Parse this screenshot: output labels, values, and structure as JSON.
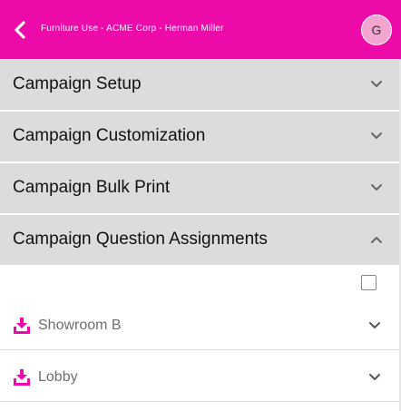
{
  "header": {
    "title": "Furniture Use - ACME Corp - Herman Miller",
    "avatar_initial": "G",
    "brand_color": "#ec0aa8",
    "back_icon": "chevron-left-icon"
  },
  "sections": [
    {
      "label": "Campaign Setup",
      "expanded": false
    },
    {
      "label": "Campaign Customization",
      "expanded": false
    },
    {
      "label": "Campaign Bulk Print",
      "expanded": false
    },
    {
      "label": "Campaign Question Assignments",
      "expanded": true
    }
  ],
  "assignments": {
    "select_all_checked": false,
    "items": [
      {
        "label": "Showroom B",
        "icon": "download-tray-icon"
      },
      {
        "label": "Lobby",
        "icon": "download-tray-icon"
      }
    ]
  }
}
